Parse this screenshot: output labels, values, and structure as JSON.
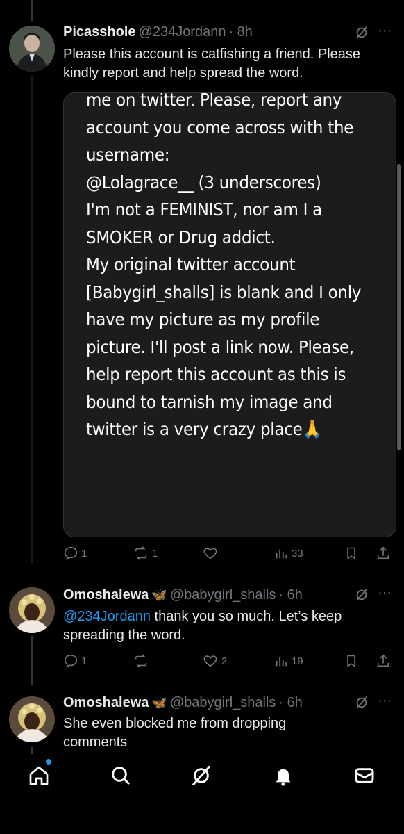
{
  "tweets": [
    {
      "name": "Picasshole",
      "handle": "@234Jordann",
      "time": "· 8h",
      "text": "Please this account is catfishing a friend. Please kindly report and help spread the word.",
      "embed_lines": [
        "me on twitter. Please, report any",
        "account you come across with the",
        "username:",
        "@Lolagrace__ (3 underscores)",
        "I'm not a FEMINIST, nor am I a",
        "SMOKER or Drug addict.",
        "My original twitter account",
        "[Babygirl_shalls] is blank and I only",
        "have my picture as my profile",
        "picture. I'll post a link now. Please,",
        "help report this account as this is",
        "bound to tarnish my image and",
        "twitter is a very crazy place🙏"
      ],
      "replies": "1",
      "reposts": "1",
      "likes": "",
      "views": "33"
    },
    {
      "name": "Omoshalewa",
      "badge": "🦋",
      "handle": "@babygirl_shalls",
      "time": "· 6h",
      "mention": "@234Jordann",
      "text": " thank you so much. Let’s keep spreading the word.",
      "replies": "1",
      "reposts": "",
      "likes": "2",
      "views": "19"
    },
    {
      "name": "Omoshalewa",
      "badge": "🦋",
      "handle": "@babygirl_shalls",
      "time": "· 6h",
      "text": "She even blocked me from dropping comments"
    }
  ],
  "icons": {
    "grok": "grok-icon",
    "more": "more-icon",
    "reply": "reply-icon",
    "repost": "repost-icon",
    "like": "like-icon",
    "views": "views-icon",
    "bookmark": "bookmark-icon",
    "share": "share-icon"
  },
  "nav": [
    "home-icon",
    "search-icon",
    "grok-icon",
    "notifications-icon",
    "messages-icon"
  ],
  "colors": {
    "accent": "#1d9bf0",
    "muted": "#71767b",
    "background": "#000000"
  }
}
